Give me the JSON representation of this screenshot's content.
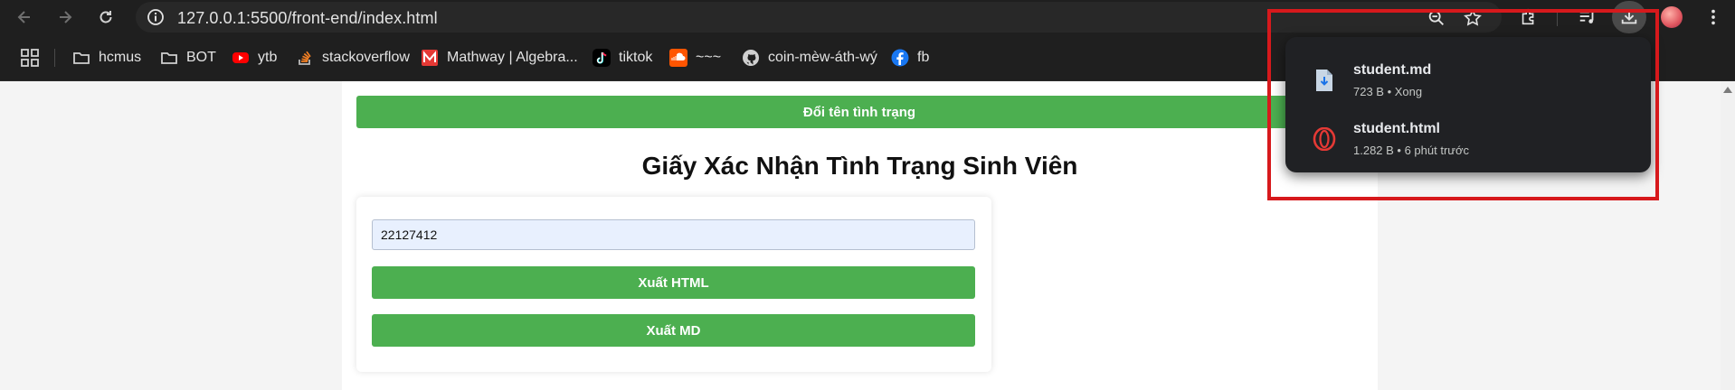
{
  "browser": {
    "url": "127.0.0.1:5500/front-end/index.html"
  },
  "bookmarks": [
    {
      "label": "hcmus",
      "icon": "folder-icon"
    },
    {
      "label": "BOT",
      "icon": "folder-icon"
    },
    {
      "label": "ytb",
      "icon": "youtube-icon"
    },
    {
      "label": "stackoverflow",
      "icon": "stackoverflow-icon"
    },
    {
      "label": "Mathway | Algebra...",
      "icon": "mathway-icon"
    },
    {
      "label": "tiktok",
      "icon": "tiktok-icon"
    },
    {
      "label": "~~~",
      "icon": "soundcloud-icon"
    },
    {
      "label": "coin-mèw-áth-wý",
      "icon": "github-icon"
    },
    {
      "label": "fb",
      "icon": "facebook-icon"
    }
  ],
  "page": {
    "rename_button": "Đổi tên tình trạng",
    "heading": "Giấy Xác Nhận Tình Trạng Sinh Viên",
    "student_id_value": "22127412",
    "export_html_button": "Xuất HTML",
    "export_md_button": "Xuất MD"
  },
  "downloads": [
    {
      "name": "student.md",
      "meta": "723 B • Xong",
      "icon": "markdown-file-icon"
    },
    {
      "name": "student.html",
      "meta": "1.282 B • 6 phút trước",
      "icon": "opera-html-file-icon"
    }
  ],
  "colors": {
    "accent_green": "#4caf50",
    "highlight_red": "#d7191c",
    "chrome_dark": "#1f1f1f",
    "popup_bg": "#202124"
  }
}
